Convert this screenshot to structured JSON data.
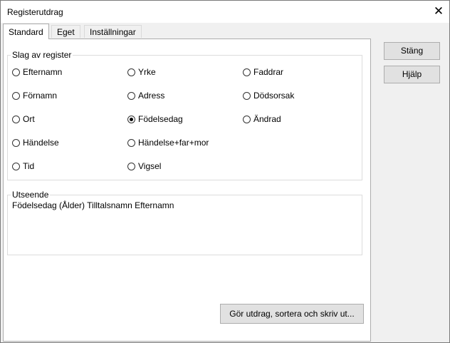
{
  "window": {
    "title": "Registerutdrag",
    "close_glyph": "✕"
  },
  "tabs": [
    {
      "label": "Standard",
      "active": true
    },
    {
      "label": "Eget",
      "active": false
    },
    {
      "label": "Inställningar",
      "active": false
    }
  ],
  "slag": {
    "legend": "Slag av register",
    "options": [
      {
        "label": "Efternamn",
        "checked": false
      },
      {
        "label": "Yrke",
        "checked": false
      },
      {
        "label": "Faddrar",
        "checked": false
      },
      {
        "label": "Förnamn",
        "checked": false
      },
      {
        "label": "Adress",
        "checked": false
      },
      {
        "label": "Dödsorsak",
        "checked": false
      },
      {
        "label": "Ort",
        "checked": false
      },
      {
        "label": "Födelsedag",
        "checked": true
      },
      {
        "label": "Ändrad",
        "checked": false
      },
      {
        "label": "Händelse",
        "checked": false
      },
      {
        "label": "Händelse+far+mor",
        "checked": false
      },
      {
        "label": "Tid",
        "checked": false
      },
      {
        "label": "Vigsel",
        "checked": false
      }
    ]
  },
  "utseende": {
    "legend": "Utseende",
    "text": "Födelsedag (Ålder) Tilltalsnamn Efternamn"
  },
  "buttons": {
    "run": "Gör utdrag, sortera och skriv ut...",
    "close": "Stäng",
    "help": "Hjälp"
  }
}
